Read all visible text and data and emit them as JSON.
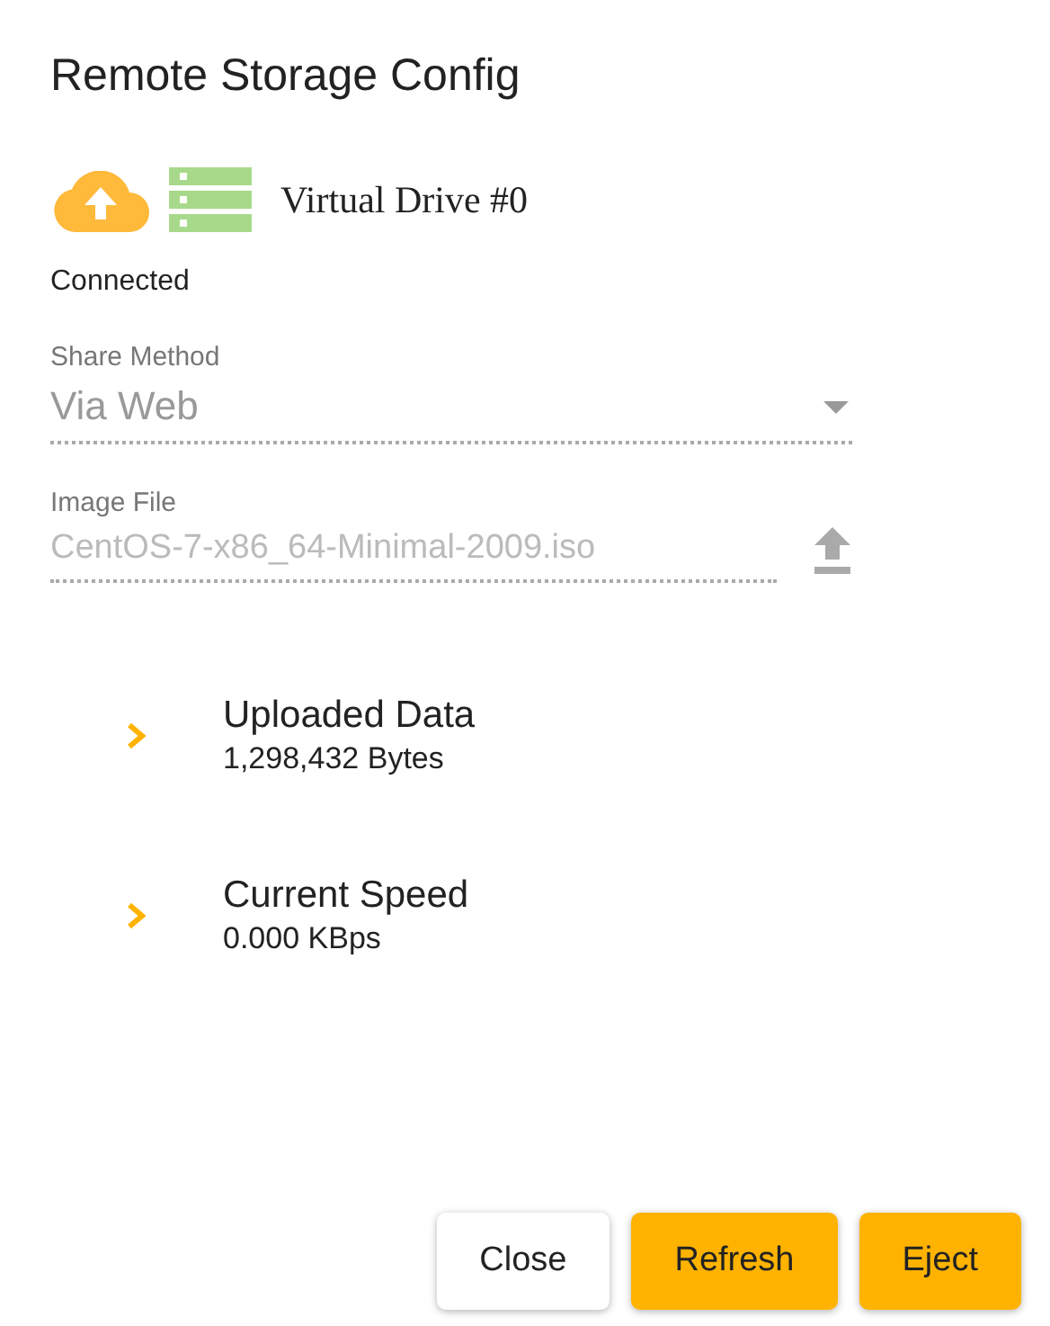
{
  "dialog": {
    "title": "Remote Storage Config"
  },
  "drive": {
    "name": "Virtual Drive #0",
    "status": "Connected"
  },
  "fields": [
    {
      "kind": "select",
      "label": "Share Method",
      "value": "Via Web",
      "disabled": true
    },
    {
      "kind": "file",
      "label": "Image File",
      "value": "CentOS-7-x86_64-Minimal-2009.iso",
      "disabled": true
    }
  ],
  "stats": [
    {
      "title": "Uploaded Data",
      "value": "1,298,432 Bytes",
      "expanded": false
    },
    {
      "title": "Current Speed",
      "value": "0.000 KBps",
      "expanded": false
    }
  ],
  "buttons": [
    {
      "label": "Close",
      "kind": "secondary"
    },
    {
      "label": "Refresh",
      "kind": "primary"
    },
    {
      "label": "Eject",
      "kind": "primary"
    }
  ]
}
